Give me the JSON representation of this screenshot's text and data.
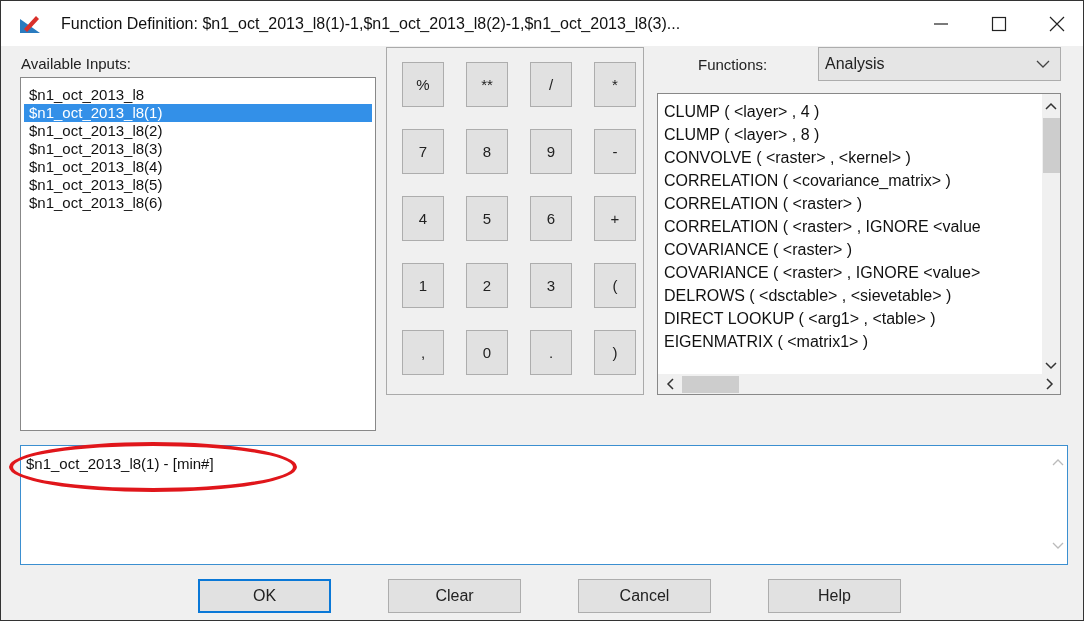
{
  "window": {
    "title": "Function Definition:  $n1_oct_2013_l8(1)-1,$n1_oct_2013_l8(2)-1,$n1_oct_2013_l8(3)..."
  },
  "inputs": {
    "label": "Available Inputs:",
    "items": [
      {
        "text": "$n1_oct_2013_l8",
        "selected": false
      },
      {
        "text": "$n1_oct_2013_l8(1)",
        "selected": true
      },
      {
        "text": "$n1_oct_2013_l8(2)",
        "selected": false
      },
      {
        "text": "$n1_oct_2013_l8(3)",
        "selected": false
      },
      {
        "text": "$n1_oct_2013_l8(4)",
        "selected": false
      },
      {
        "text": "$n1_oct_2013_l8(5)",
        "selected": false
      },
      {
        "text": "$n1_oct_2013_l8(6)",
        "selected": false
      }
    ]
  },
  "keypad": [
    "%",
    "**",
    "/",
    "*",
    "7",
    "8",
    "9",
    "-",
    "4",
    "5",
    "6",
    "+",
    "1",
    "2",
    "3",
    "(",
    ",",
    "0",
    ".",
    ")"
  ],
  "functions": {
    "label": "Functions:",
    "category": "Analysis",
    "items": [
      "CLUMP ( <layer> , 4 )",
      "CLUMP ( <layer> , 8 )",
      "CONVOLVE ( <raster> , <kernel> )",
      "CORRELATION ( <covariance_matrix> )",
      "CORRELATION ( <raster> )",
      "CORRELATION ( <raster> , IGNORE <value",
      "COVARIANCE ( <raster> )",
      "COVARIANCE ( <raster> , IGNORE <value>",
      "DELROWS ( <dsctable> , <sievetable> )",
      "DIRECT LOOKUP ( <arg1> , <table> )",
      "EIGENMATRIX ( <matrix1> )"
    ]
  },
  "expression": {
    "value": "$n1_oct_2013_l8(1) - [min#]",
    "circled": true
  },
  "buttons": [
    {
      "label": "OK",
      "default": true
    },
    {
      "label": "Clear",
      "default": false
    },
    {
      "label": "Cancel",
      "default": false
    },
    {
      "label": "Help",
      "default": false
    }
  ]
}
